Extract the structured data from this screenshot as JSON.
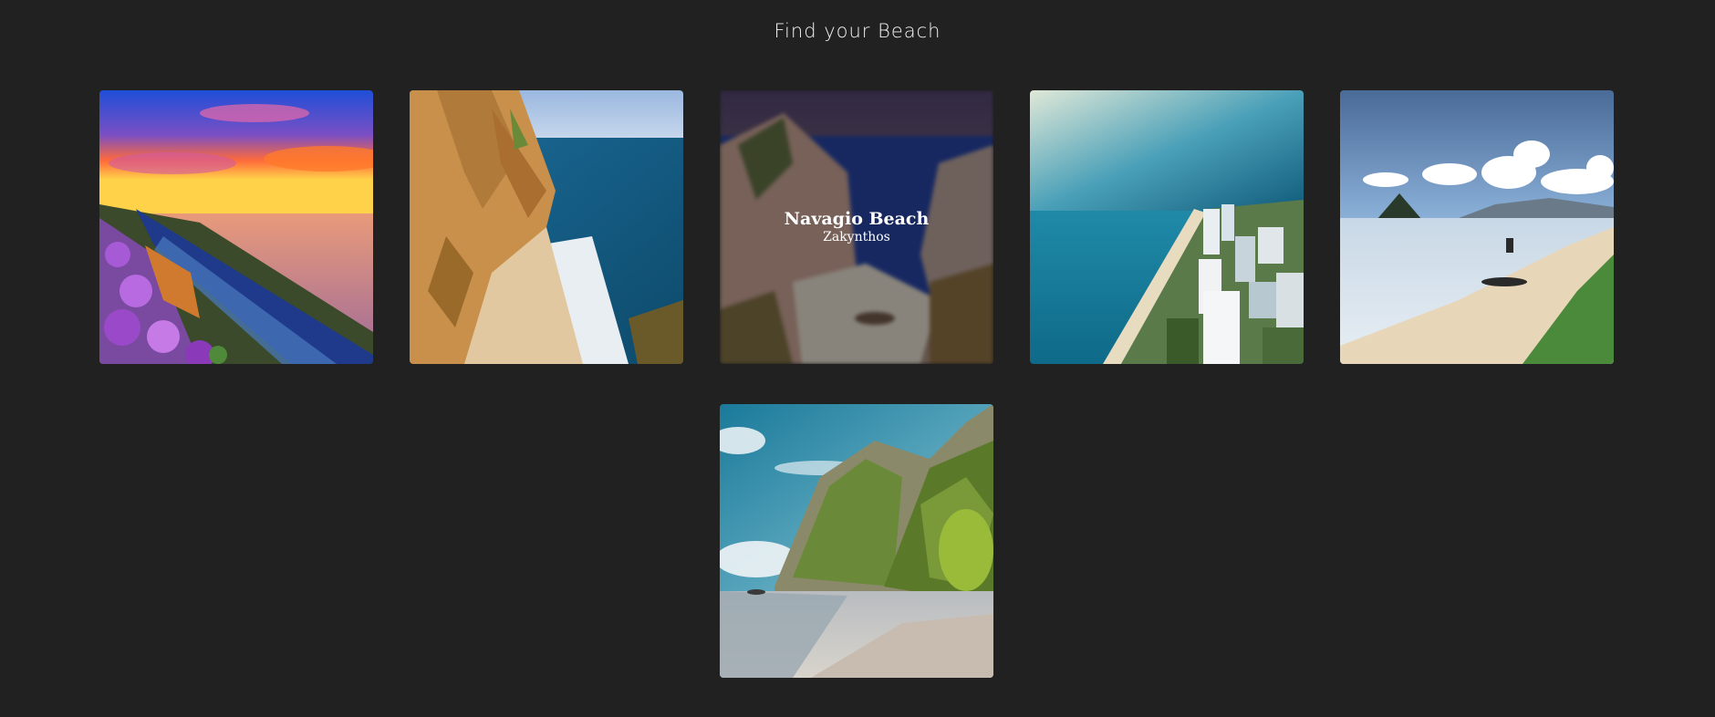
{
  "page": {
    "title": "Find your Beach",
    "background": "#212121"
  },
  "beaches": [
    {
      "id": "sunset-coast",
      "image": "sunset coastline with purple flowers and train"
    },
    {
      "id": "cliff-beach",
      "image": "sandy cove below tall sandstone cliff"
    },
    {
      "id": "navagio",
      "name": "Navagio Beach",
      "place": "Zakynthos",
      "hovered": true,
      "image": "shipwreck cove between cliffs"
    },
    {
      "id": "city-coast",
      "image": "aerial coastline with high-rise city"
    },
    {
      "id": "island-shore",
      "image": "misty shore with small island peak"
    },
    {
      "id": "limestone-bay",
      "image": "jungle limestone cliff above sandy beach"
    }
  ]
}
